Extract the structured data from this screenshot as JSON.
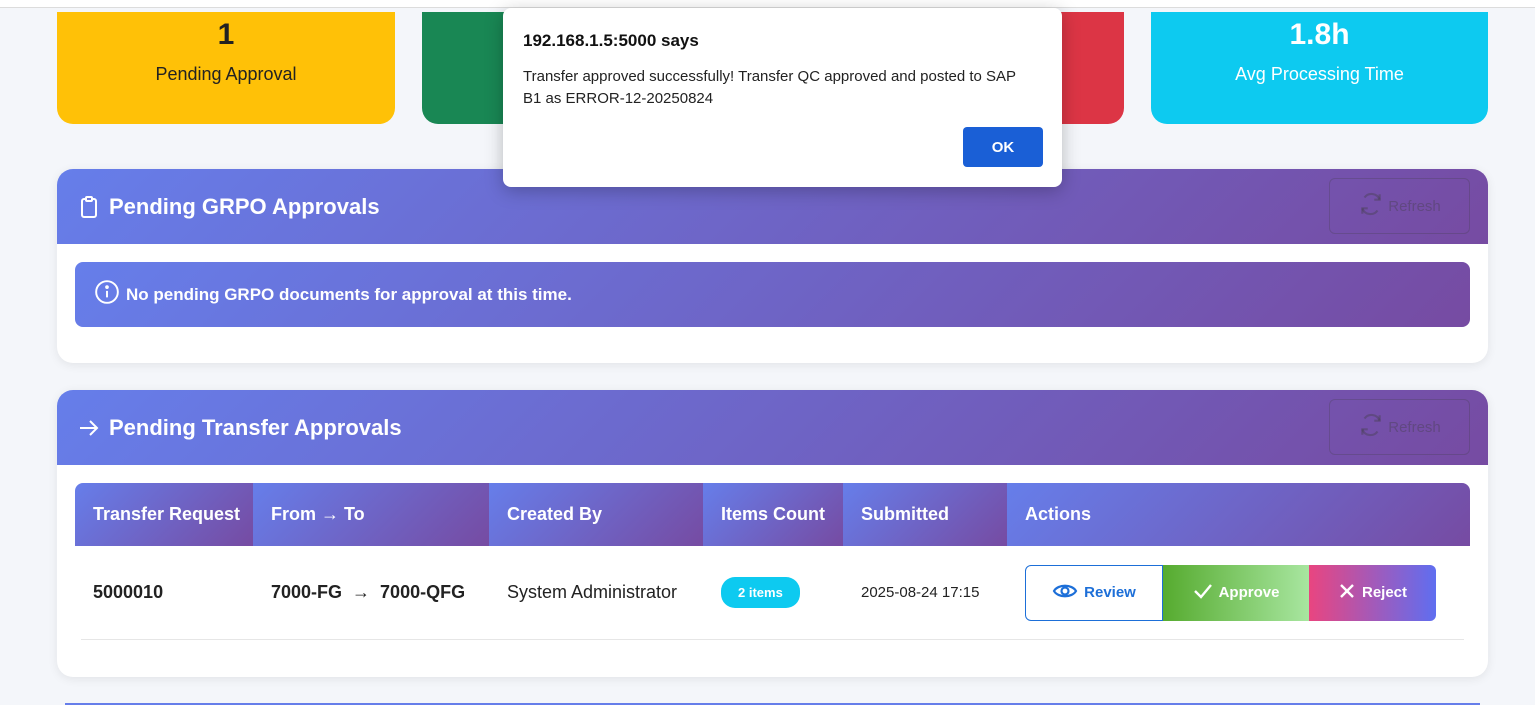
{
  "stats": [
    {
      "value": "1",
      "label": "Pending Approval"
    },
    {
      "value": "",
      "label": ""
    },
    {
      "value": "",
      "label": ""
    },
    {
      "value": "1.8h",
      "label": "Avg Processing Time"
    }
  ],
  "grpo": {
    "title": "Pending GRPO Approvals",
    "refresh_label": "Refresh",
    "empty_message": "No pending GRPO documents for approval at this time."
  },
  "transfer": {
    "title": "Pending Transfer Approvals",
    "refresh_label": "Refresh",
    "columns": [
      "Transfer Request",
      "From → To",
      "Created By",
      "Items Count",
      "Submitted",
      "Actions"
    ],
    "rows": [
      {
        "request": "5000010",
        "from": "7000-FG",
        "arrow": "→",
        "to": "7000-QFG",
        "created_by": "System Administrator",
        "items": "2 items",
        "submitted": "2025-08-24 17:15",
        "review_label": "Review",
        "approve_label": "Approve",
        "reject_label": "Reject"
      }
    ]
  },
  "dialog": {
    "title": "192.168.1.5:5000 says",
    "message": "Transfer approved successfully! Transfer QC approved and posted to SAP B1 as ERROR-12-20250824",
    "ok_label": "OK"
  },
  "colors": {
    "yellow": "#ffc107",
    "green": "#198754",
    "red": "#dc3545",
    "cyan": "#0dcaf0",
    "gradient_start": "#667eea",
    "gradient_end": "#764ba2",
    "ok_button": "#1a5fd6"
  },
  "icons": [
    "clipboard-icon",
    "refresh-icon",
    "info-icon",
    "arrow-right-icon",
    "eye-icon",
    "check-icon",
    "x-icon"
  ]
}
